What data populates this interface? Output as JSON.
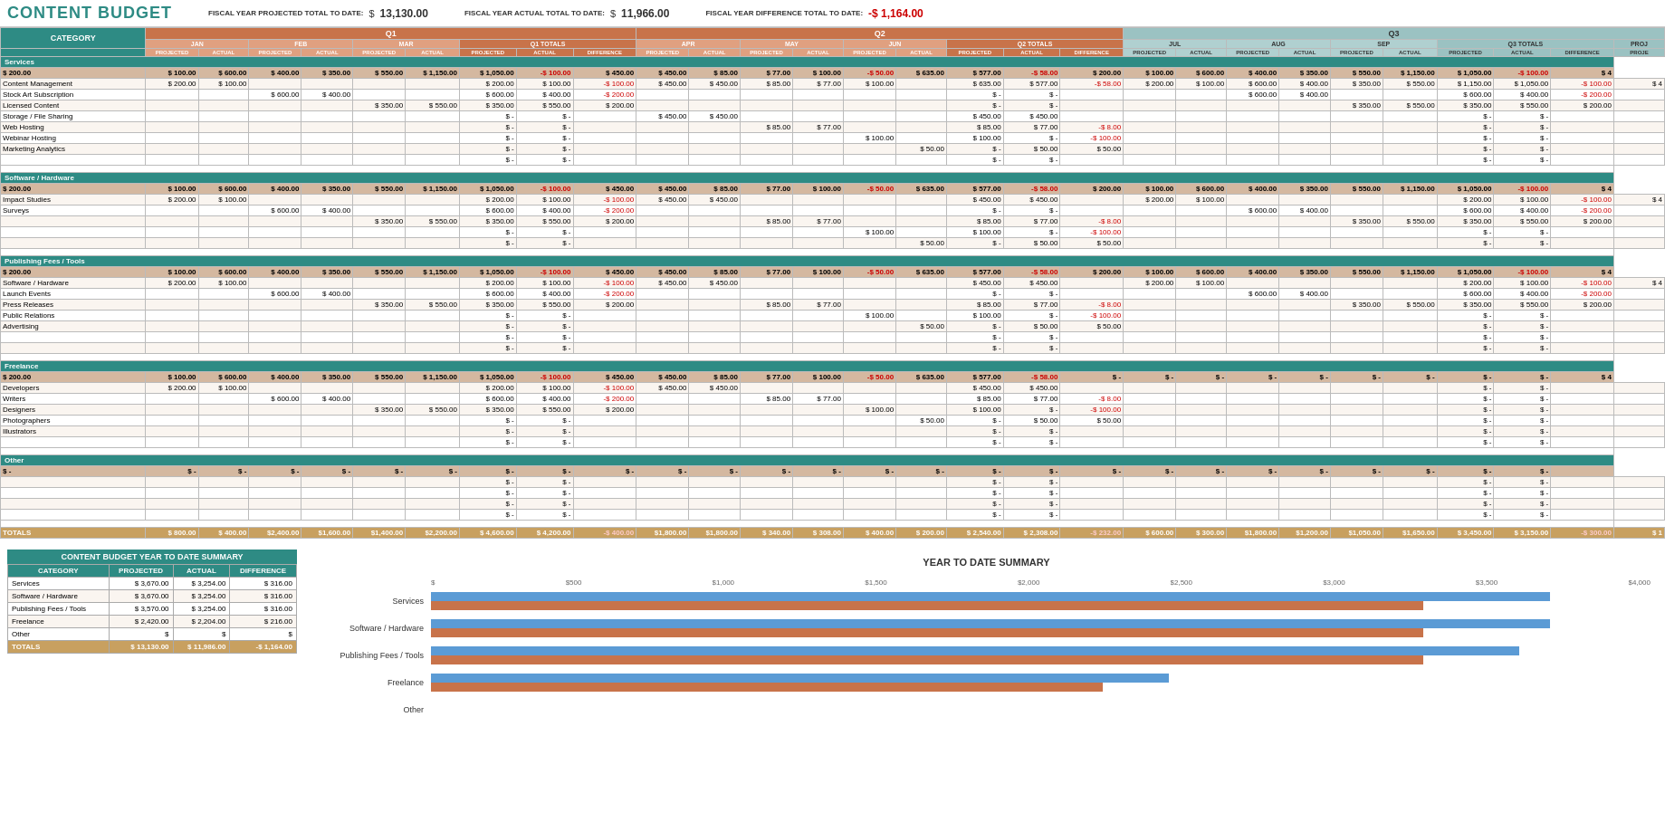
{
  "header": {
    "title": "CONTENT BUDGET",
    "fiscal_projected_label": "FISCAL YEAR PROJECTED TOTAL TO DATE:",
    "fiscal_projected_value": "13,130.00",
    "fiscal_actual_label": "FISCAL YEAR ACTUAL TOTAL TO DATE:",
    "fiscal_actual_value": "11,966.00",
    "fiscal_diff_label": "FISCAL YEAR DIFFERENCE TOTAL TO DATE:",
    "fiscal_diff_value": "-$ 1,164.00"
  },
  "quarters": {
    "q1": "Q1",
    "q2": "Q2",
    "q3": "Q3"
  },
  "col_months": [
    "JAN",
    "FEB",
    "MAR",
    "Q1 TOTALS",
    "APR",
    "MAY",
    "JUN",
    "Q2 TOTALS",
    "JUL",
    "AUG",
    "SEP",
    "Q3 TOTALS"
  ],
  "sub_cols": [
    "PROJECTED",
    "ACTUAL",
    "PROJECTED",
    "ACTUAL",
    "PROJECTED",
    "ACTUAL",
    "PROJECTED",
    "ACTUAL",
    "DIFFERENCE",
    "PROJECTED",
    "ACTUAL",
    "PROJECTED",
    "ACTUAL",
    "PROJECTED",
    "ACTUAL",
    "PROJECTED",
    "ACTUAL",
    "DIFFERENCE",
    "PROJECTED",
    "ACTUAL",
    "PROJECTED",
    "ACTUAL",
    "PROJECTED",
    "ACTUAL",
    "PROJECTED",
    "ACTUAL",
    "DIFFERENCE",
    "PROJ"
  ],
  "ytd_summary": {
    "title": "CONTENT BUDGET YEAR TO DATE SUMMARY",
    "headers": [
      "CATEGORY",
      "PROJECTED",
      "ACTUAL",
      "DIFFERENCE"
    ],
    "rows": [
      {
        "cat": "Services",
        "proj": "$ 3,670.00",
        "actual": "$ 3,254.00",
        "diff": "$ 316.00"
      },
      {
        "cat": "Software / Hardware",
        "proj": "$ 3,670.00",
        "actual": "$ 3,254.00",
        "diff": "$ 316.00"
      },
      {
        "cat": "Publishing Fees / Tools",
        "proj": "$ 3,570.00",
        "actual": "$ 3,254.00",
        "diff": "$ 316.00"
      },
      {
        "cat": "Freelance",
        "proj": "$ 2,420.00",
        "actual": "$ 2,204.00",
        "diff": "$ 216.00"
      },
      {
        "cat": "Other",
        "proj": "$",
        "actual": "$",
        "diff": "$"
      }
    ],
    "totals": {
      "cat": "TOTALS",
      "proj": "$ 13,130.00",
      "actual": "$ 11,986.00",
      "diff": "-$ 1,164.00"
    }
  },
  "chart": {
    "title": "YEAR TO DATE SUMMARY",
    "x_labels": [
      "$",
      "$500",
      "$1,000",
      "$1,500",
      "$2,000",
      "$2,500",
      "$3,000",
      "$3,500",
      "$4,000"
    ],
    "categories": [
      {
        "label": "Services",
        "projected": 3670,
        "actual": 3254
      },
      {
        "label": "Software / Hardware",
        "projected": 3670,
        "actual": 3254
      },
      {
        "label": "Publishing Fees / Tools",
        "projected": 3570,
        "actual": 3254
      },
      {
        "label": "Freelance",
        "projected": 2420,
        "actual": 2204
      },
      {
        "label": "Other",
        "projected": 0,
        "actual": 0
      }
    ],
    "max_value": 4000
  },
  "sections": [
    {
      "name": "Services",
      "rows": [
        {
          "cat": "Content Management",
          "jan_p": "$ 200.00",
          "jan_a": "$ 100.00",
          "feb_p": "",
          "feb_a": "",
          "mar_p": "",
          "mar_a": "",
          "q1_p": "$ 200.00",
          "q1_a": "$ 100.00",
          "q1_d": "-$ 100.00",
          "apr_p": "$ 450.00",
          "apr_a": "$ 450.00",
          "may_p": "$ 85.00",
          "may_a": "$ 77.00",
          "jun_p": "$ 100.00",
          "jun_a": "",
          "q2_p": "$ 635.00",
          "q2_a": "$ 577.00",
          "q2_d": "-$ 58.00",
          "jul_p": "$ 200.00",
          "jul_a": "$ 100.00",
          "aug_p": "$ 600.00",
          "aug_a": "$ 400.00",
          "sep_p": "$ 350.00",
          "sep_a": "$ 550.00",
          "q3_p": "$ 1,150.00",
          "q3_a": "$ 1,050.00",
          "q3_d": "-$ 100.00"
        },
        {
          "cat": "Stock Art Subscription",
          "jan_p": "",
          "jan_a": "",
          "feb_p": "$ 600.00",
          "feb_a": "$ 400.00",
          "mar_p": "",
          "mar_a": "",
          "q1_p": "$ 600.00",
          "q1_a": "$ 400.00",
          "q1_d": "-$ 200.00",
          "apr_p": "",
          "apr_a": "",
          "may_p": "",
          "may_a": "",
          "jun_p": "",
          "jun_a": "",
          "q2_p": "$ -",
          "q2_a": "$ -",
          "q2_d": "",
          "jul_p": "",
          "jul_a": "",
          "aug_p": "$ 600.00",
          "aug_a": "$ 400.00",
          "sep_p": "",
          "sep_a": "",
          "q3_p": "$ 600.00",
          "q3_a": "$ 400.00",
          "q3_d": "-$ 200.00"
        },
        {
          "cat": "Licensed Content",
          "jan_p": "",
          "jan_a": "",
          "feb_p": "",
          "feb_a": "",
          "mar_p": "$ 350.00",
          "mar_a": "$ 550.00",
          "q1_p": "$ 350.00",
          "q1_a": "$ 550.00",
          "q1_d": "$ 200.00",
          "apr_p": "",
          "apr_a": "",
          "may_p": "",
          "may_a": "",
          "jun_p": "",
          "jun_a": "",
          "q2_p": "$ -",
          "q2_a": "$ -",
          "q2_d": "",
          "jul_p": "",
          "jul_a": "",
          "aug_p": "",
          "aug_a": "",
          "sep_p": "$ 350.00",
          "sep_a": "$ 550.00",
          "q3_p": "$ 350.00",
          "q3_a": "$ 550.00",
          "q3_d": "$ 200.00"
        },
        {
          "cat": "Storage / File Sharing",
          "jan_p": "",
          "jan_a": "",
          "feb_p": "",
          "feb_a": "",
          "mar_p": "",
          "mar_a": "",
          "q1_p": "$ -",
          "q1_a": "$ -",
          "q1_d": "",
          "apr_p": "$ 450.00",
          "apr_a": "$ 450.00",
          "may_p": "",
          "may_a": "",
          "jun_p": "",
          "jun_a": "",
          "q2_p": "$ 450.00",
          "q2_a": "$ 450.00",
          "q2_d": "",
          "jul_p": "",
          "jul_a": "",
          "aug_p": "",
          "aug_a": "",
          "sep_p": "",
          "sep_a": "",
          "q3_p": "$ -",
          "q3_a": "$ -",
          "q3_d": ""
        },
        {
          "cat": "Web Hosting",
          "jan_p": "",
          "jan_a": "",
          "feb_p": "",
          "feb_a": "",
          "mar_p": "",
          "mar_a": "",
          "q1_p": "$ -",
          "q1_a": "$ -",
          "q1_d": "",
          "apr_p": "",
          "apr_a": "",
          "may_p": "$ 85.00",
          "may_a": "$ 77.00",
          "jun_p": "",
          "jun_a": "",
          "q2_p": "$ 85.00",
          "q2_a": "$ 77.00",
          "q2_d": "-$ 8.00",
          "jul_p": "",
          "jul_a": "",
          "aug_p": "",
          "aug_a": "",
          "sep_p": "",
          "sep_a": "",
          "q3_p": "$ -",
          "q3_a": "$ -",
          "q3_d": ""
        },
        {
          "cat": "Webinar Hosting",
          "jan_p": "",
          "jan_a": "",
          "feb_p": "",
          "feb_a": "",
          "mar_p": "",
          "mar_a": "",
          "q1_p": "$ -",
          "q1_a": "$ -",
          "q1_d": "",
          "apr_p": "",
          "apr_a": "",
          "may_p": "",
          "may_a": "",
          "jun_p": "$ 100.00",
          "jun_a": "",
          "q2_p": "$ 100.00",
          "q2_a": "$ -",
          "q2_d": "-$ 100.00",
          "jul_p": "",
          "jul_a": "",
          "aug_p": "",
          "aug_a": "",
          "sep_p": "",
          "sep_a": "",
          "q3_p": "$ -",
          "q3_a": "$ -",
          "q3_d": ""
        },
        {
          "cat": "Marketing Analytics",
          "jan_p": "",
          "jan_a": "",
          "feb_p": "",
          "feb_a": "",
          "mar_p": "",
          "mar_a": "",
          "q1_p": "$ -",
          "q1_a": "$ -",
          "q1_d": "",
          "apr_p": "",
          "apr_a": "",
          "may_p": "",
          "may_a": "",
          "jun_p": "",
          "jun_a": "$ 50.00",
          "q2_p": "$ -",
          "q2_a": "$ 50.00",
          "q2_d": "$ 50.00",
          "jul_p": "",
          "jul_a": "",
          "aug_p": "",
          "aug_a": "",
          "sep_p": "",
          "sep_a": "",
          "q3_p": "$ -",
          "q3_a": "$ -",
          "q3_d": ""
        },
        {
          "cat": "",
          "jan_p": "",
          "jan_a": "",
          "feb_p": "",
          "feb_a": "",
          "mar_p": "",
          "mar_a": "",
          "q1_p": "$ -",
          "q1_a": "$ -",
          "q1_d": "",
          "apr_p": "",
          "apr_a": "",
          "may_p": "",
          "may_a": "",
          "jun_p": "",
          "jun_a": "",
          "q2_p": "$ -",
          "q2_a": "$ -",
          "q2_d": "",
          "jul_p": "",
          "jul_a": "",
          "aug_p": "",
          "aug_a": "",
          "sep_p": "",
          "sep_a": "",
          "q3_p": "$ -",
          "q3_a": "$ -",
          "q3_d": ""
        }
      ],
      "subtotal": {
        "jan_p": "$ 200.00",
        "jan_a": "$ 100.00",
        "feb_p": "$ 600.00",
        "feb_a": "$ 400.00",
        "mar_p": "$ 350.00",
        "mar_a": "$ 550.00",
        "q1_p": "$ 1,150.00",
        "q1_a": "$ 1,050.00",
        "q1_d": "-$ 100.00",
        "apr_p": "$ 450.00",
        "apr_a": "$ 450.00",
        "may_p": "$ 85.00",
        "may_a": "$ 77.00",
        "jun_p": "$ 100.00",
        "jun_a": "-$ 50.00",
        "q2_p": "$ 635.00",
        "q2_a": "$ 577.00",
        "q2_d": "-$ 58.00",
        "jul_p": "$ 200.00",
        "jul_a": "$ 100.00",
        "aug_p": "$ 600.00",
        "aug_a": "$ 400.00",
        "sep_p": "$ 350.00",
        "sep_a": "$ 550.00",
        "q3_p": "$ 1,150.00",
        "q3_a": "$ 1,050.00",
        "q3_d": "-$ 100.00"
      }
    }
  ],
  "totals_row": {
    "jan_p": "$ 800.00",
    "jan_a": "$ 400.00",
    "feb_p": "$2,400.00",
    "feb_a": "$1,600.00",
    "mar_p": "$1,400.00",
    "mar_a": "$2,200.00",
    "q1_p": "$ 4,600.00",
    "q1_a": "$ 4,200.00",
    "q1_d": "-$ 400.00",
    "apr_p": "$1,800.00",
    "apr_a": "$1,800.00",
    "may_p": "$ 340.00",
    "may_a": "$ 308.00",
    "jun_p": "$ 400.00",
    "jun_a": "$ 200.00",
    "q2_p": "$ 2,540.00",
    "q2_a": "$ 2,308.00",
    "q2_d": "-$ 232.00",
    "jul_p": "$ 600.00",
    "jul_a": "$ 300.00",
    "aug_p": "$1,800.00",
    "aug_a": "$1,200.00",
    "sep_p": "$1,050.00",
    "sep_a": "$1,650.00",
    "q3_p": "$ 3,450.00",
    "q3_a": "$ 3,150.00",
    "q3_d": "-$ 300.00",
    "proj": "$ 1"
  }
}
